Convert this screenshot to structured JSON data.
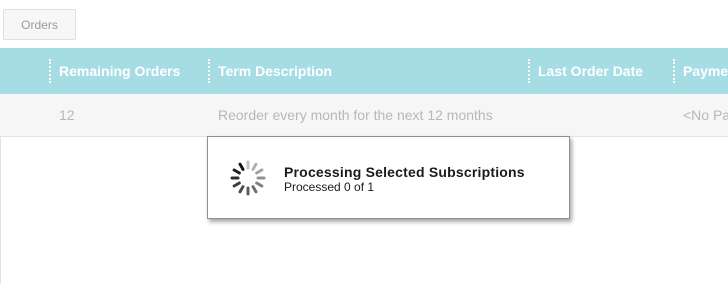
{
  "toolbar": {
    "orders_label": "Orders"
  },
  "grid": {
    "columns": [
      {
        "label": "Remaining Orders"
      },
      {
        "label": "Term Description"
      },
      {
        "label": "Last Order Date"
      },
      {
        "label": "Payme"
      }
    ],
    "rows": [
      {
        "remaining_orders": "12",
        "term_description": "Reorder every month for the next 12 months",
        "last_order_date": "",
        "payment": "<No Pa"
      }
    ]
  },
  "modal": {
    "title": "Processing Selected Subscriptions",
    "status": "Processed 0 of 1",
    "icon": "loading-spinner-icon"
  },
  "colors": {
    "header_bg": "#a6dde5",
    "header_text": "#ffffff",
    "row_bg": "#f6f6f6",
    "row_text": "#b8b8b8"
  }
}
